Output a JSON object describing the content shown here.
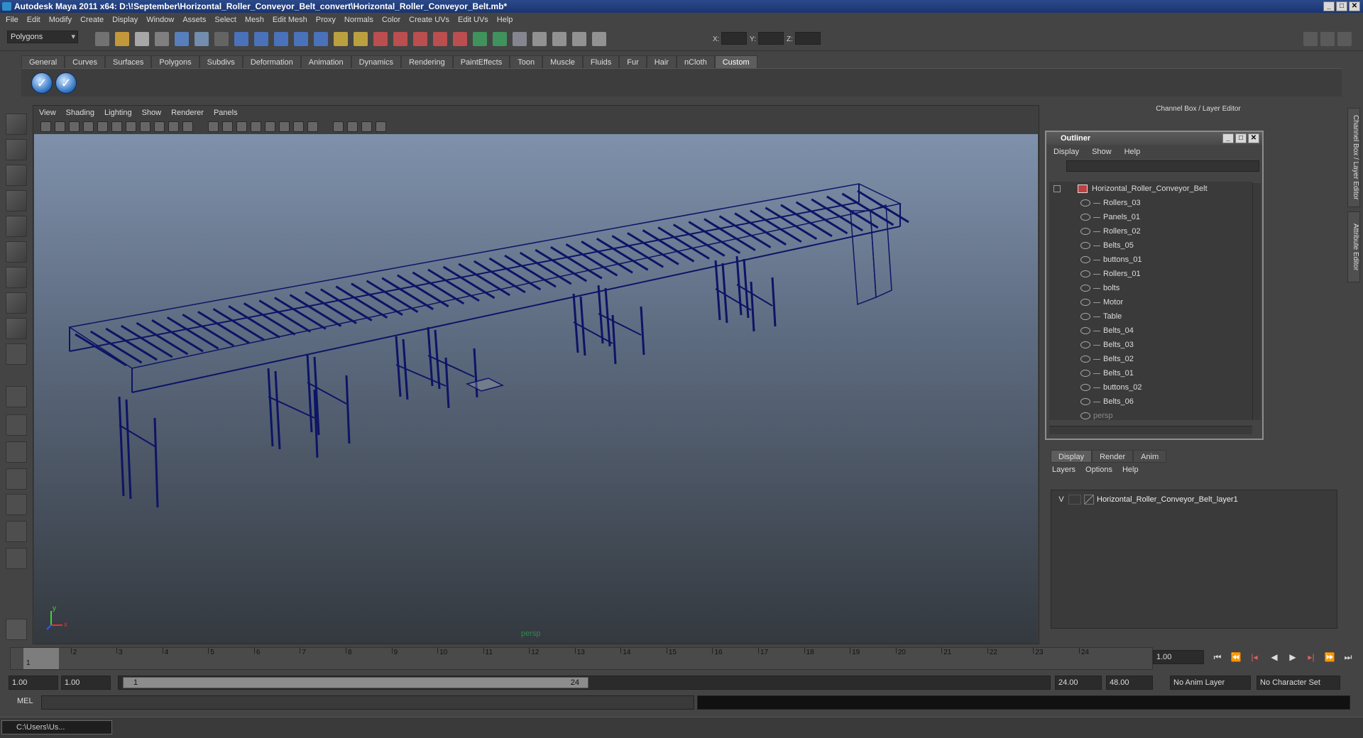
{
  "window": {
    "title": "Autodesk Maya 2011 x64: D:\\!September\\Horizontal_Roller_Conveyor_Belt_convert\\Horizontal_Roller_Conveyor_Belt.mb*",
    "controls": [
      "_",
      "□",
      "✕"
    ]
  },
  "menubar": [
    "File",
    "Edit",
    "Modify",
    "Create",
    "Display",
    "Window",
    "Assets",
    "Select",
    "Mesh",
    "Edit Mesh",
    "Proxy",
    "Normals",
    "Color",
    "Create UVs",
    "Edit UVs",
    "Help"
  ],
  "statusline": {
    "mode": "Polygons",
    "coord_labels": [
      "X:",
      "Y:",
      "Z:"
    ]
  },
  "shelf": {
    "tabs": [
      "General",
      "Curves",
      "Surfaces",
      "Polygons",
      "Subdivs",
      "Deformation",
      "Animation",
      "Dynamics",
      "Rendering",
      "PaintEffects",
      "Toon",
      "Muscle",
      "Fluids",
      "Fur",
      "Hair",
      "nCloth",
      "Custom"
    ],
    "active_tab": "Custom",
    "button_glyph": "✓"
  },
  "viewport": {
    "menu": [
      "View",
      "Shading",
      "Lighting",
      "Show",
      "Renderer",
      "Panels"
    ],
    "camera_label": "persp",
    "axis_y": "y",
    "axis_x": "x",
    "wire_color": "#0d1466"
  },
  "channel_box": {
    "title": "Channel Box / Layer Editor",
    "side_tabs": [
      "Channel Box / Layer Editor",
      "Attribute Editor"
    ]
  },
  "outliner": {
    "title": "Outliner",
    "menu": [
      "Display",
      "Show",
      "Help"
    ],
    "root": "Horizontal_Roller_Conveyor_Belt",
    "children": [
      "Rollers_03",
      "Panels_01",
      "Rollers_02",
      "Belts_05",
      "buttons_01",
      "Rollers_01",
      "bolts",
      "Motor",
      "Table",
      "Belts_04",
      "Belts_03",
      "Belts_02",
      "Belts_01",
      "buttons_02",
      "Belts_06"
    ],
    "camera": "persp"
  },
  "layer_editor": {
    "tabs": [
      "Display",
      "Render",
      "Anim"
    ],
    "active_tab": "Display",
    "menu": [
      "Layers",
      "Options",
      "Help"
    ],
    "layer_visibility": "V",
    "layer_name": "Horizontal_Roller_Conveyor_Belt_layer1"
  },
  "timeline": {
    "ticks": [
      "1",
      "2",
      "3",
      "4",
      "5",
      "6",
      "7",
      "8",
      "9",
      "10",
      "11",
      "12",
      "13",
      "14",
      "15",
      "16",
      "17",
      "18",
      "19",
      "20",
      "21",
      "22",
      "23",
      "24"
    ],
    "current_frame_label": "1",
    "current_time": "1.00"
  },
  "range": {
    "start": "1.00",
    "playback_start": "1.00",
    "handle_start": "1",
    "handle_end": "24",
    "playback_end": "24.00",
    "end": "48.00",
    "anim_layer": "No Anim Layer",
    "character_set": "No Character Set"
  },
  "command_line": {
    "label": "MEL"
  },
  "taskbar": {
    "item": "C:\\Users\\Us..."
  }
}
